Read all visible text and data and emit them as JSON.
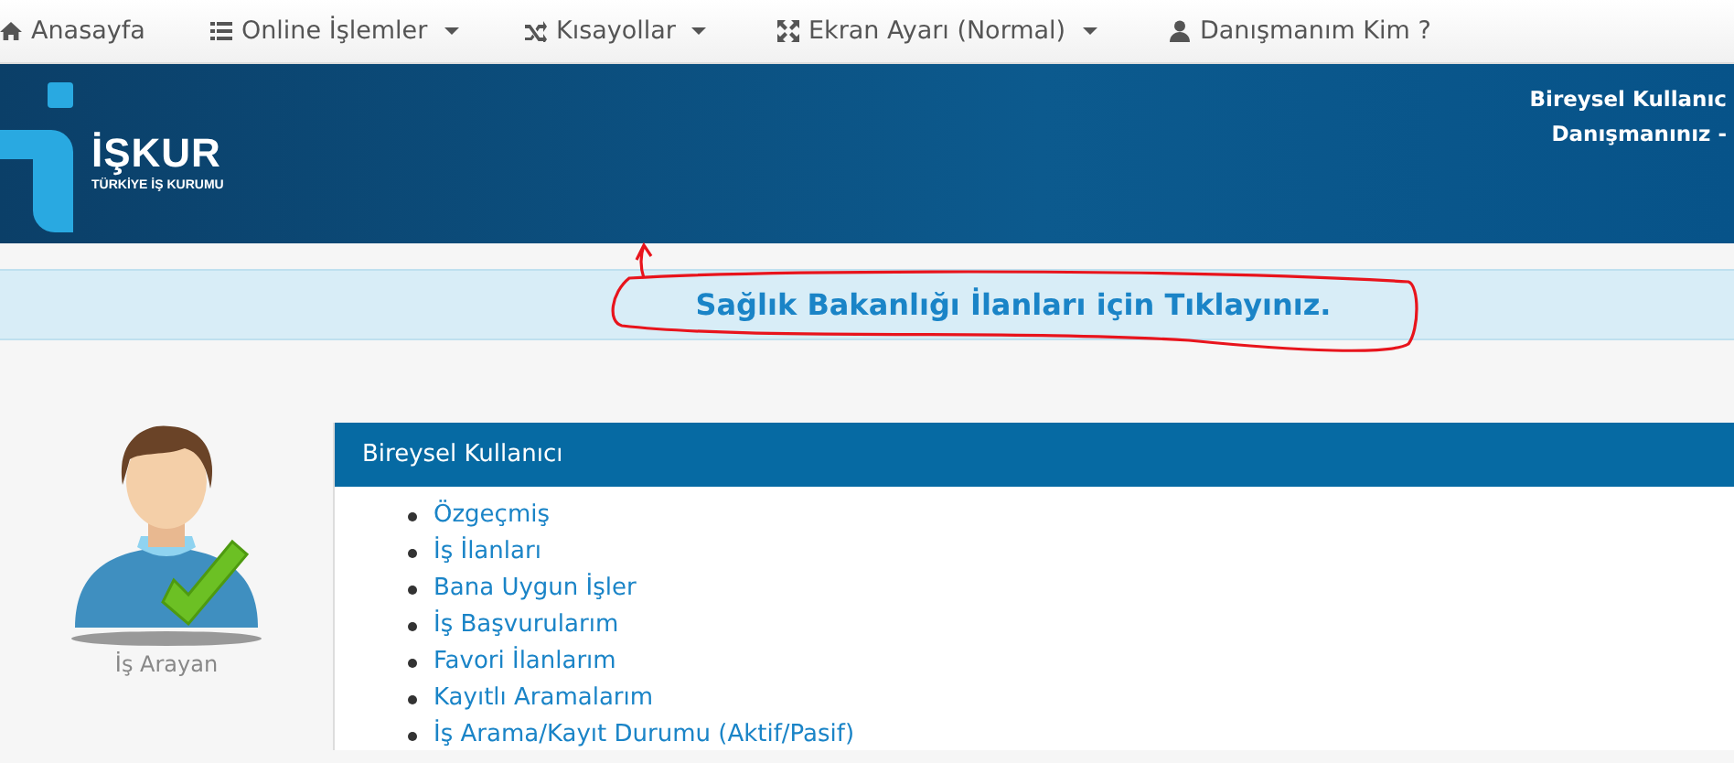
{
  "navbar": {
    "items": [
      {
        "label": "Anasayfa",
        "kind": "home",
        "dropdown": false
      },
      {
        "label": "Online İşlemler",
        "kind": "list",
        "dropdown": true
      },
      {
        "label": "Kısayollar",
        "kind": "shuffle",
        "dropdown": true
      },
      {
        "label": "Ekran Ayarı (Normal)",
        "kind": "expand",
        "dropdown": true
      },
      {
        "label": "Danışmanım Kim ?",
        "kind": "user",
        "dropdown": false
      }
    ]
  },
  "header": {
    "logo_title": "İŞKUR",
    "logo_subtitle": "TÜRKİYE İŞ KURUMU",
    "user_lines": [
      "Bireysel Kullanıc",
      "Danışmanınız -"
    ]
  },
  "banner": {
    "link": "Sağlık Bakanlığı İlanları için Tıklayınız."
  },
  "profile": {
    "caption": "İş Arayan"
  },
  "panel": {
    "title": "Bireysel Kullanıcı",
    "links": [
      "Özgeçmiş",
      "İş İlanları",
      "Bana Uygun İşler",
      "İş Başvurularım",
      "Favori İlanlarım",
      "Kayıtlı Aramalarım",
      "İş Arama/Kayıt Durumu (Aktif/Pasif)"
    ]
  }
}
